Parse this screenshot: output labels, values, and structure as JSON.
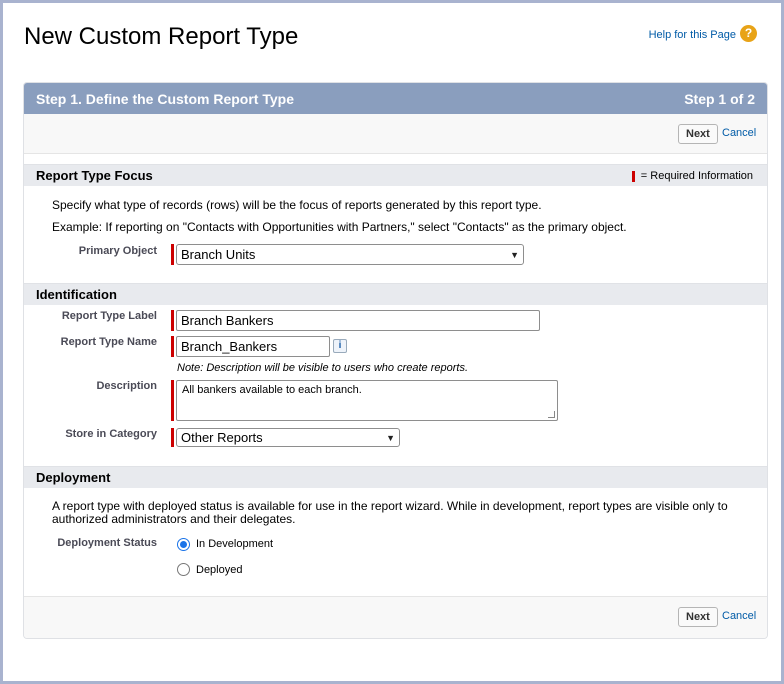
{
  "page": {
    "title": "New Custom Report Type",
    "help_link": "Help for this Page",
    "help_icon": "?"
  },
  "step": {
    "title": "Step 1. Define the Custom Report Type",
    "counter": "Step 1 of 2"
  },
  "buttons": {
    "next": "Next",
    "cancel": "Cancel"
  },
  "focus_section": {
    "heading": "Report Type Focus",
    "required_legend": "= Required Information",
    "description": "Specify what type of records (rows) will be the focus of reports generated by this report type.",
    "example": "Example: If reporting on \"Contacts with Opportunities with Partners,\" select \"Contacts\" as the primary object.",
    "primary_object_label": "Primary Object",
    "primary_object_value": "Branch Units"
  },
  "identification": {
    "heading": "Identification",
    "label_label": "Report Type Label",
    "label_value": "Branch Bankers",
    "name_label": "Report Type Name",
    "name_value": "Branch_Bankers",
    "info_icon": "i",
    "note": "Note: Description will be visible to users who create reports.",
    "description_label": "Description",
    "description_value": "All bankers available to each branch.",
    "category_label": "Store in Category",
    "category_value": "Other Reports"
  },
  "deployment": {
    "heading": "Deployment",
    "description": "A report type with deployed status is available for use in the report wizard. While in development, report types are visible only to authorized administrators and their delegates.",
    "status_label": "Deployment Status",
    "options": [
      {
        "label": "In Development",
        "checked": true
      },
      {
        "label": "Deployed",
        "checked": false
      }
    ]
  },
  "colors": {
    "step_header": "#8a9ebe",
    "required": "#cc0000",
    "link": "#015ba7",
    "radio_selected": "#1a73e8"
  }
}
